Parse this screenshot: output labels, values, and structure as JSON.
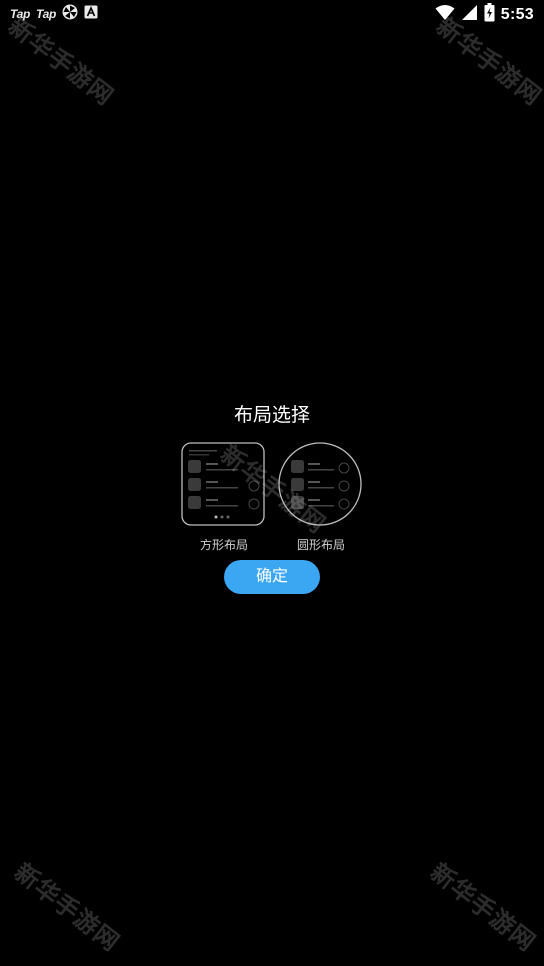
{
  "status_bar": {
    "left_icons": [
      {
        "name": "taptap-icon",
        "text": "Tap"
      },
      {
        "name": "taptap-icon",
        "text": "Tap"
      },
      {
        "name": "pinwheel-icon"
      },
      {
        "name": "font-a-icon"
      }
    ],
    "time": "5:53",
    "right_icons": [
      "wifi-icon",
      "signal-icon",
      "battery-charging-icon"
    ]
  },
  "dialog": {
    "title": "布局选择",
    "options": [
      {
        "label": "方形布局",
        "shape": "square"
      },
      {
        "label": "圆形布局",
        "shape": "round"
      }
    ],
    "confirm_label": "确定",
    "accent_color": "#3ba6f2"
  },
  "watermark": {
    "text": "新华手游网"
  }
}
